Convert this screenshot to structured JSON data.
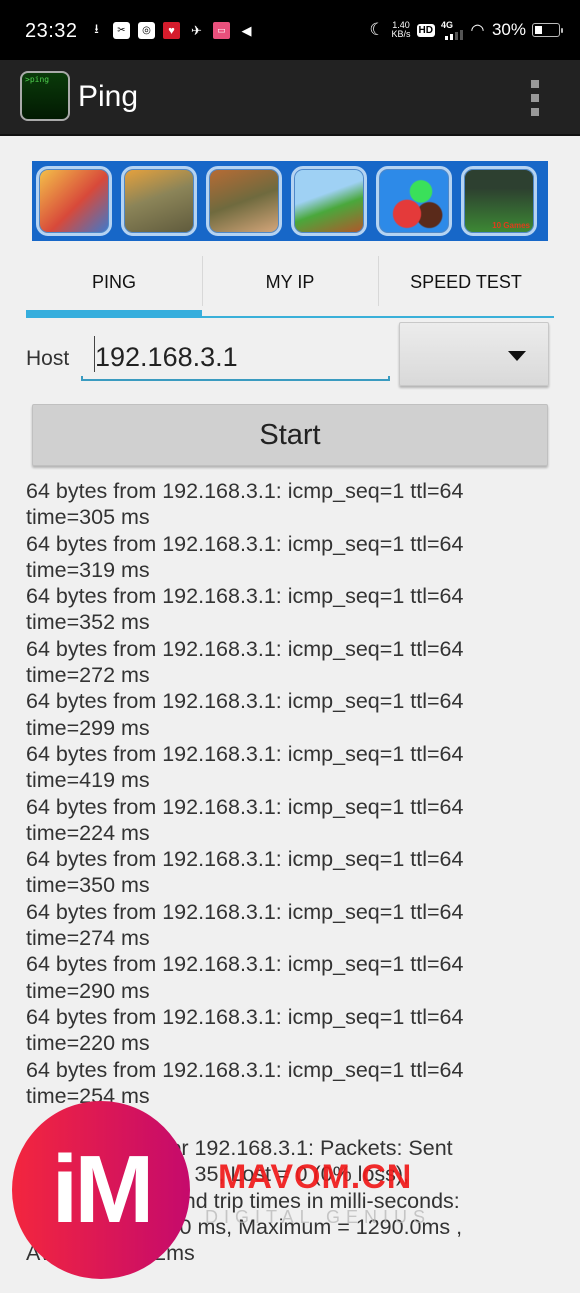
{
  "status_bar": {
    "time": "23:32",
    "net_speed_value": "1.40",
    "net_speed_unit": "KB/s",
    "hd_label": "HD",
    "network_type": "4G",
    "battery_percent": "30%",
    "battery_level": 0.3
  },
  "action_bar": {
    "app_icon_text": ">ping",
    "title": "Ping"
  },
  "ad_banner": {
    "tiles": [
      {
        "name": "game-ad-subway-runner",
        "caption": ""
      },
      {
        "name": "game-ad-tank",
        "caption": ""
      },
      {
        "name": "game-ad-soldier",
        "caption": ""
      },
      {
        "name": "game-ad-platformer",
        "caption": ""
      },
      {
        "name": "game-ad-candy",
        "caption": ""
      },
      {
        "name": "game-ad-soccer",
        "caption": "10 Games"
      }
    ]
  },
  "tabs": [
    {
      "label": "PING",
      "active": true
    },
    {
      "label": "MY IP",
      "active": false
    },
    {
      "label": "SPEED TEST",
      "active": false
    }
  ],
  "host": {
    "label": "Host",
    "value": "192.168.3.1",
    "protocol_selected": ""
  },
  "start_button": {
    "label": "Start"
  },
  "colors": {
    "accent": "#36aedd",
    "action_bar": "#222222",
    "background": "#f0f0f0"
  },
  "output": {
    "log": [
      "64 bytes from 192.168.3.1: icmp_seq=1 ttl=64",
      "time=305 ms",
      "64 bytes from 192.168.3.1: icmp_seq=1 ttl=64",
      "time=319 ms",
      "64 bytes from 192.168.3.1: icmp_seq=1 ttl=64",
      "time=352 ms",
      "64 bytes from 192.168.3.1: icmp_seq=1 ttl=64",
      "time=272 ms",
      "64 bytes from 192.168.3.1: icmp_seq=1 ttl=64",
      "time=299 ms",
      "64 bytes from 192.168.3.1: icmp_seq=1 ttl=64",
      "time=419 ms",
      "64 bytes from 192.168.3.1: icmp_seq=1 ttl=64",
      "time=224 ms",
      "64 bytes from 192.168.3.1: icmp_seq=1 ttl=64",
      "time=350 ms",
      "64 bytes from 192.168.3.1: icmp_seq=1 ttl=64",
      "time=274 ms",
      "64 bytes from 192.168.3.1: icmp_seq=1 ttl=64",
      "time=290 ms",
      "64 bytes from 192.168.3.1: icmp_seq=1 ttl=64",
      "time=220 ms",
      "64 bytes from 192.168.3.1: icmp_seq=1 ttl=64",
      "time=254 ms"
    ],
    "summary_lines": [
      "Ping statistics for 192.168.3.1: Packets: Sent",
      "= 35, Received = 35, Lost = 0 (0% loss),",
      "Approximate round trip times in milli-seconds:",
      "Minimum = 220.0 ms, Maximum = 1290.0ms ,",
      "Average = 352ms"
    ]
  },
  "watermark": {
    "logo_text": "iM",
    "site": "MAVOM.CN",
    "tagline": "DIGITAL GENIUS"
  }
}
